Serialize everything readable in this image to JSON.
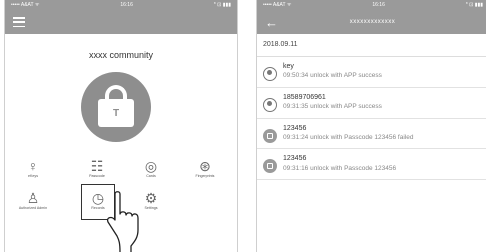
{
  "left": {
    "status": {
      "carrier": "••••• A&AT ᯤ",
      "time": "16:16",
      "battery": "* ⊡ ▮▮▮"
    },
    "community_title": "xxxx community",
    "grid": [
      {
        "name": "ekey",
        "label": "eKeys",
        "icon": "♀"
      },
      {
        "name": "passcode",
        "label": "Passcode",
        "icon": "☷"
      },
      {
        "name": "cards",
        "label": "Cards",
        "icon": "◎"
      },
      {
        "name": "fingerprints",
        "label": "Fingerprints",
        "icon": "⊛"
      },
      {
        "name": "authorized-admin",
        "label": "Authorized Admin",
        "icon": "♙"
      },
      {
        "name": "records",
        "label": "Records",
        "icon": "◷"
      },
      {
        "name": "settings",
        "label": "Settings",
        "icon": "⚙"
      }
    ]
  },
  "right": {
    "status": {
      "carrier": "••••• A&AT ᯤ",
      "time": "16:16",
      "battery": "* ⊡ ▮▮▮"
    },
    "title": "xxxxxxxxxxxxx",
    "date": "2018.09.11",
    "entries": [
      {
        "name": "key",
        "detail": "09:50:34 unlock with APP success",
        "icon": "user"
      },
      {
        "name": "18589706961",
        "detail": "09:31:35 unlock with APP success",
        "icon": "user"
      },
      {
        "name": "123456",
        "detail": "09:31:24 unlock with Passcode 123456 failed",
        "icon": "code"
      },
      {
        "name": "123456",
        "detail": "09:31:16 unlock with Passcode 123456",
        "icon": "code"
      }
    ]
  },
  "colors": {
    "appbar": "#9a9a9a",
    "lock": "#8e8e8e"
  }
}
